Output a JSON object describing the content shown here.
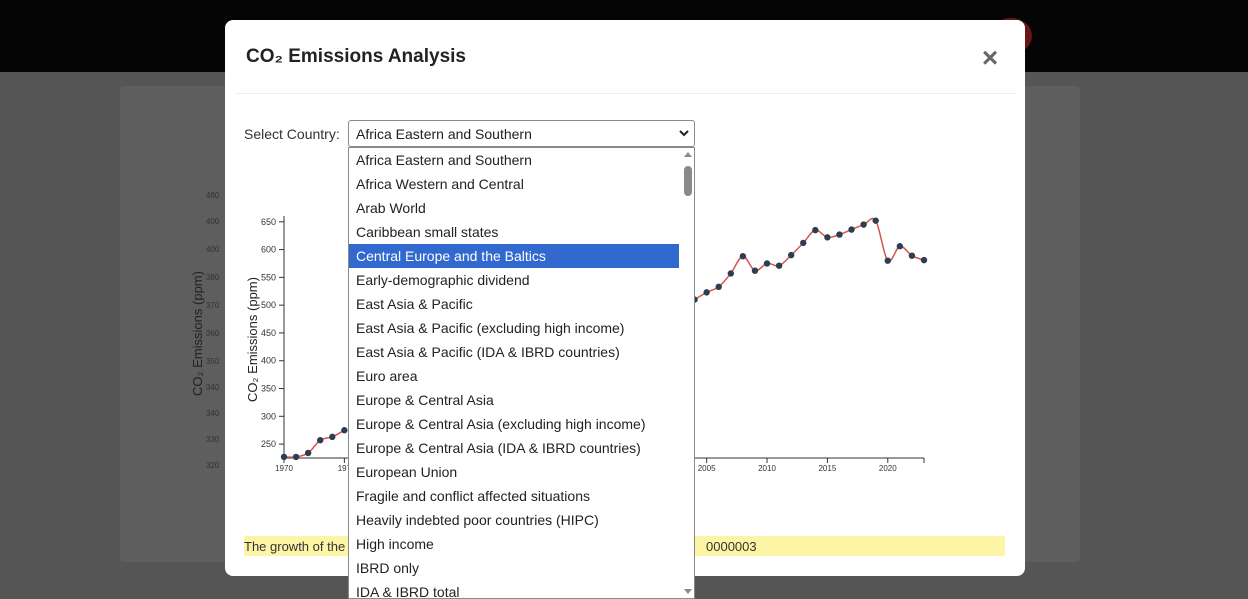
{
  "modal": {
    "title": "CO₂ Emissions Analysis",
    "close_label": "×"
  },
  "selector": {
    "label": "Select Country:",
    "value": "Africa Eastern and Southern",
    "options": [
      "Africa Eastern and Southern",
      "Africa Western and Central",
      "Arab World",
      "Caribbean small states",
      "Central Europe and the Baltics",
      "Early-demographic dividend",
      "East Asia & Pacific",
      "East Asia & Pacific (excluding high income)",
      "East Asia & Pacific (IDA & IBRD countries)",
      "Euro area",
      "Europe & Central Asia",
      "Europe & Central Asia (excluding high income)",
      "Europe & Central Asia (IDA & IBRD countries)",
      "European Union",
      "Fragile and conflict affected situations",
      "Heavily indebted poor countries (HIPC)",
      "High income",
      "IBRD only",
      "IDA & IBRD total"
    ],
    "highlighted": "Central Europe and the Baltics"
  },
  "note": {
    "left": "The growth of the",
    "right": "0000003"
  },
  "background_chart": {
    "ylabel": "CO₂ Emissions (ppm)"
  },
  "chart_data": {
    "type": "scatter",
    "ylabel": "CO₂ Emissions (ppm)",
    "yticks": [
      250,
      300,
      350,
      400,
      450,
      500,
      550,
      600,
      650
    ],
    "xticks": [
      "1970",
      "1975",
      "2005",
      "2010",
      "2015",
      "2020"
    ],
    "xtick_labels_shown": [
      "1970",
      "197",
      "2005",
      "2010",
      "2015",
      "2020"
    ],
    "ylim": [
      225,
      655
    ],
    "xlim": [
      1970,
      2023
    ],
    "points_visible": [
      {
        "x": 1970,
        "y": 227
      },
      {
        "x": 1971,
        "y": 227
      },
      {
        "x": 1972,
        "y": 234
      },
      {
        "x": 1973,
        "y": 257
      },
      {
        "x": 1974,
        "y": 263
      },
      {
        "x": 1975,
        "y": 275
      },
      {
        "x": 2004,
        "y": 510
      },
      {
        "x": 2005,
        "y": 523
      },
      {
        "x": 2006,
        "y": 533
      },
      {
        "x": 2007,
        "y": 557
      },
      {
        "x": 2008,
        "y": 588
      },
      {
        "x": 2009,
        "y": 562
      },
      {
        "x": 2010,
        "y": 575
      },
      {
        "x": 2011,
        "y": 571
      },
      {
        "x": 2012,
        "y": 590
      },
      {
        "x": 2013,
        "y": 612
      },
      {
        "x": 2014,
        "y": 635
      },
      {
        "x": 2015,
        "y": 622
      },
      {
        "x": 2016,
        "y": 627
      },
      {
        "x": 2017,
        "y": 636
      },
      {
        "x": 2018,
        "y": 645
      },
      {
        "x": 2019,
        "y": 652
      },
      {
        "x": 2020,
        "y": 580
      },
      {
        "x": 2021,
        "y": 606
      },
      {
        "x": 2022,
        "y": 589
      },
      {
        "x": 2023,
        "y": 581
      }
    ],
    "line_color": "#d9534f",
    "point_color": "#2c3e50"
  }
}
